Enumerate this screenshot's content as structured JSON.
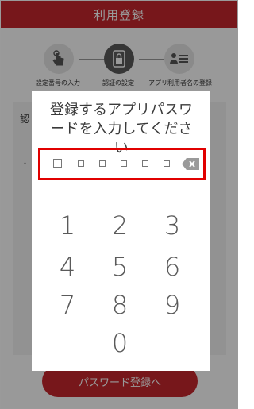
{
  "header": {
    "title": "利用登録"
  },
  "stepper": {
    "steps": [
      {
        "label": "設定番号の入力",
        "icon": "hand-tap-icon",
        "state": "inactive"
      },
      {
        "label": "認証の設定",
        "icon": "phone-lock-icon",
        "state": "active"
      },
      {
        "label": "アプリ利用者名の登録",
        "icon": "user-list-icon",
        "state": "inactive"
      }
    ]
  },
  "background": {
    "cta_label": "パスワード登録へ"
  },
  "modal": {
    "title": "登録するアプリパスワードを入力してください",
    "pin_length": 6,
    "pin_entered": 0,
    "keypad": [
      "1",
      "2",
      "3",
      "4",
      "5",
      "6",
      "7",
      "8",
      "9",
      "0"
    ],
    "backspace_icon": "backspace-icon"
  },
  "colors": {
    "accent": "#c7272d",
    "highlight_border": "#e10000"
  }
}
